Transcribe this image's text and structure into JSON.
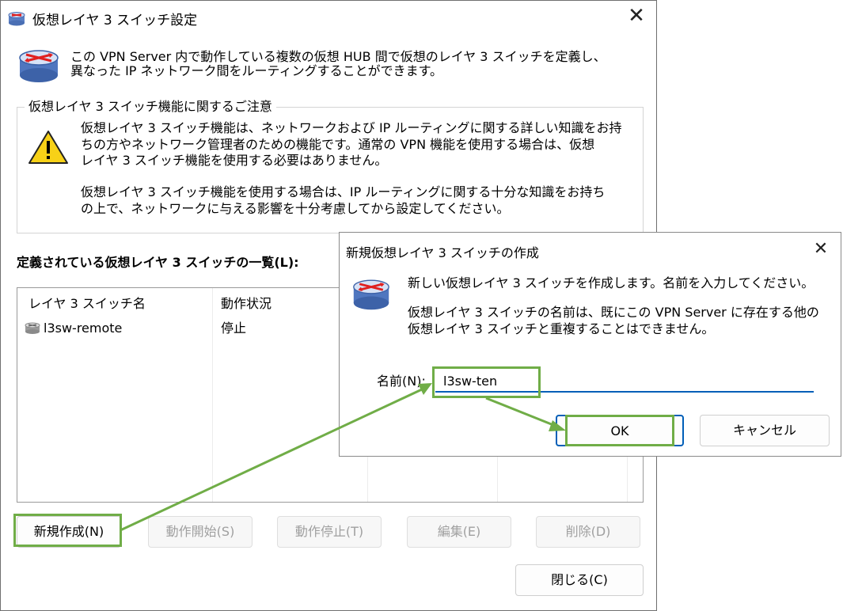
{
  "main_window": {
    "title": "仮想レイヤ 3 スイッチ設定",
    "close": "✕",
    "description_line1": "この VPN Server 内で動作している複数の仮想 HUB 間で仮想のレイヤ 3 スイッチを定義し、",
    "description_line2": "異なった IP ネットワーク間をルーティングすることができます。",
    "notice_title": "仮想レイヤ 3 スイッチ機能に関するご注意",
    "notice_p1_line1": "仮想レイヤ 3 スイッチ機能は、ネットワークおよび IP ルーティングに関する詳しい知識をお持",
    "notice_p1_line2": "ちの方やネットワーク管理者のための機能です。通常の VPN 機能を使用する場合は、仮想",
    "notice_p1_line3": "レイヤ 3 スイッチ機能を使用する必要はありません。",
    "notice_p2_line1": "仮想レイヤ 3 スイッチ機能を使用する場合は、IP ルーティングに関する十分な知識をお持ち",
    "notice_p2_line2": "の上で、ネットワークに与える影響を十分考慮してから設定してください。",
    "list_label": "定義されている仮想レイヤ 3 スイッチの一覧(L):",
    "columns": [
      "レイヤ 3 スイッチ名",
      "動作状況"
    ],
    "rows": [
      {
        "name": "l3sw-remote",
        "status": "停止"
      }
    ],
    "buttons": {
      "new": "新規作成(N)",
      "start": "動作開始(S)",
      "stop": "動作停止(T)",
      "edit": "編集(E)",
      "delete": "削除(D)",
      "close": "閉じる(C)"
    }
  },
  "dialog": {
    "title": "新規仮想レイヤ 3 スイッチの作成",
    "close": "✕",
    "message1": "新しい仮想レイヤ 3 スイッチを作成します。名前を入力してください。",
    "message2_line1": "仮想レイヤ 3 スイッチの名前は、既にこの VPN Server に存在する他の",
    "message2_line2": "仮想レイヤ 3 スイッチと重複することはできません。",
    "name_label": "名前(N):",
    "name_value": "l3sw-ten",
    "ok": "OK",
    "cancel": "キャンセル"
  },
  "colors": {
    "highlight": "#70ad47",
    "input_underline": "#005fb8",
    "router_blue": "#4472c4",
    "router_arrows": "#e02020",
    "warning_yellow": "#f7d117"
  },
  "icons": [
    "router-icon",
    "warning-icon",
    "close-icon"
  ]
}
